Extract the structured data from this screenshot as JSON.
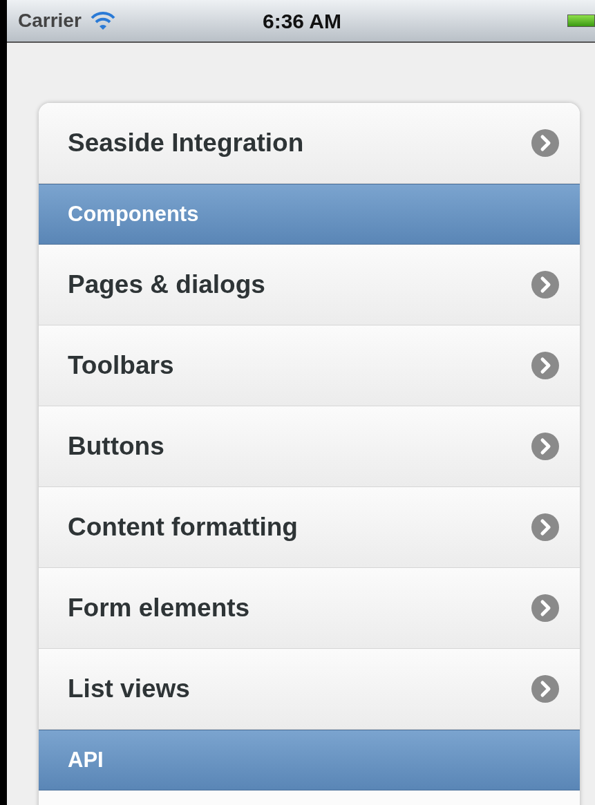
{
  "status_bar": {
    "carrier": "Carrier",
    "time": "6:36 AM"
  },
  "list": [
    {
      "kind": "item",
      "label": "Seaside Integration"
    },
    {
      "kind": "header",
      "label": "Components"
    },
    {
      "kind": "item",
      "label": "Pages & dialogs"
    },
    {
      "kind": "item",
      "label": "Toolbars"
    },
    {
      "kind": "item",
      "label": "Buttons"
    },
    {
      "kind": "item",
      "label": "Content formatting"
    },
    {
      "kind": "item",
      "label": "Form elements"
    },
    {
      "kind": "item",
      "label": "List views"
    },
    {
      "kind": "header",
      "label": "API"
    }
  ]
}
